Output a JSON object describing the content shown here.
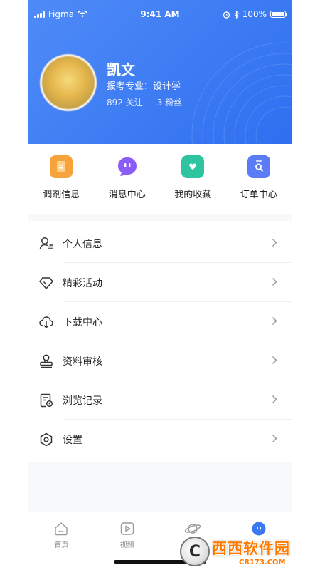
{
  "status_bar": {
    "carrier": "Figma",
    "time": "9:41 AM",
    "battery": "100%"
  },
  "profile": {
    "name": "凯文",
    "major": "报考专业：设计学",
    "following": "892 关注",
    "followers": "3 粉丝"
  },
  "quick_actions": [
    {
      "label": "调剂信息",
      "icon": "document-icon",
      "color": "#f7a23a"
    },
    {
      "label": "消息中心",
      "icon": "message-bubble-icon",
      "color": "#8b5cf6"
    },
    {
      "label": "我的收藏",
      "icon": "heart-bookmark-icon",
      "color": "#2ec4a0"
    },
    {
      "label": "订单中心",
      "icon": "clipboard-search-icon",
      "color": "#5b7cf5"
    }
  ],
  "menu": [
    {
      "label": "个人信息",
      "icon": "user-profile-icon"
    },
    {
      "label": "精彩活动",
      "icon": "diamond-icon"
    },
    {
      "label": "下载中心",
      "icon": "cloud-download-icon"
    },
    {
      "label": "资料审核",
      "icon": "stamp-icon"
    },
    {
      "label": "浏览记录",
      "icon": "history-document-icon"
    },
    {
      "label": "设置",
      "icon": "settings-hexagon-icon"
    }
  ],
  "bottom_nav": [
    {
      "label": "首页",
      "icon": "home-icon"
    },
    {
      "label": "视频",
      "icon": "video-play-icon"
    },
    {
      "label": "",
      "icon": "planet-icon"
    },
    {
      "label": "",
      "icon": "profile-face-icon",
      "active": true
    }
  ],
  "watermark": {
    "main": "西西软件园",
    "sub": "CR173.COM",
    "logo_letter": "C"
  },
  "colors": {
    "header_start": "#4f8bf7",
    "header_end": "#2f6ff0",
    "accent": "#3b77f3"
  }
}
